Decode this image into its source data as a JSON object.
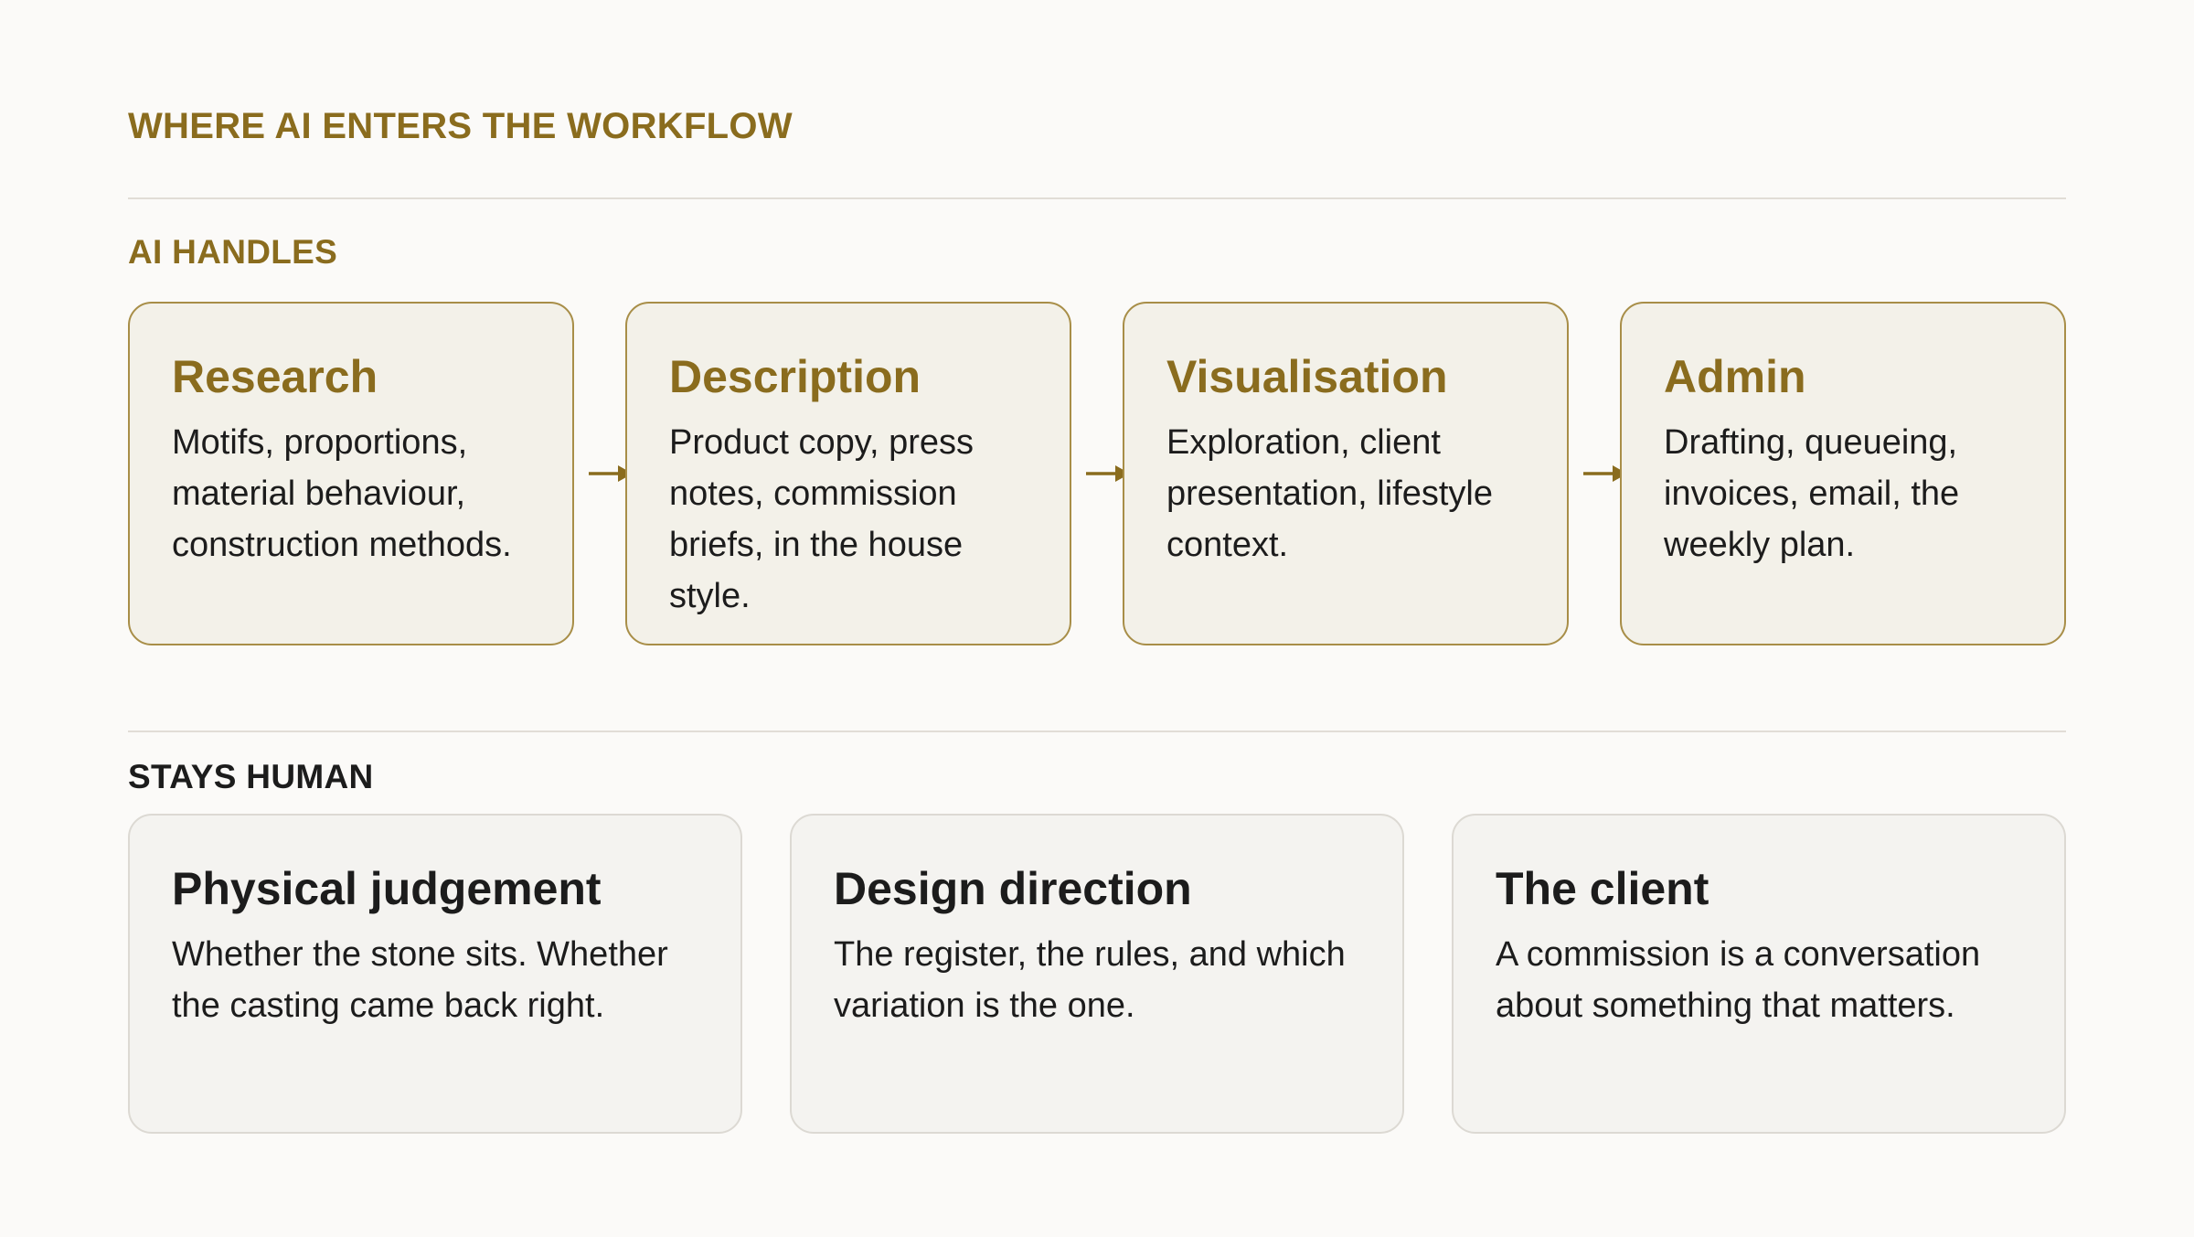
{
  "title": "WHERE AI ENTERS THE WORKFLOW",
  "ai_section": {
    "label": "AI HANDLES",
    "cards": [
      {
        "title": "Research",
        "body": "Motifs, proportions, material behaviour, construction methods."
      },
      {
        "title": "Description",
        "body": "Product copy, press notes, commission briefs, in the house style."
      },
      {
        "title": "Visualisation",
        "body": "Exploration, client presentation, lifestyle context."
      },
      {
        "title": "Admin",
        "body": "Drafting, queueing, invoices, email, the weekly plan."
      }
    ]
  },
  "human_section": {
    "label": "STAYS HUMAN",
    "cards": [
      {
        "title": "Physical judgement",
        "body": "Whether the stone sits. Whether the casting came back right."
      },
      {
        "title": "Design direction",
        "body": "The register, the rules, and which variation is the one."
      },
      {
        "title": "The client",
        "body": "A commission is a conversation about something that matters."
      }
    ]
  },
  "colors": {
    "accent": "#8a6c1e",
    "ai_card_bg": "#f3f1e9",
    "ai_card_border": "#a88e48",
    "human_card_bg": "#f4f3f0",
    "human_card_border": "#dcd9d3",
    "page_bg": "#fbfaf8"
  },
  "icons": {
    "flow_connector": "arrow-right-icon"
  }
}
